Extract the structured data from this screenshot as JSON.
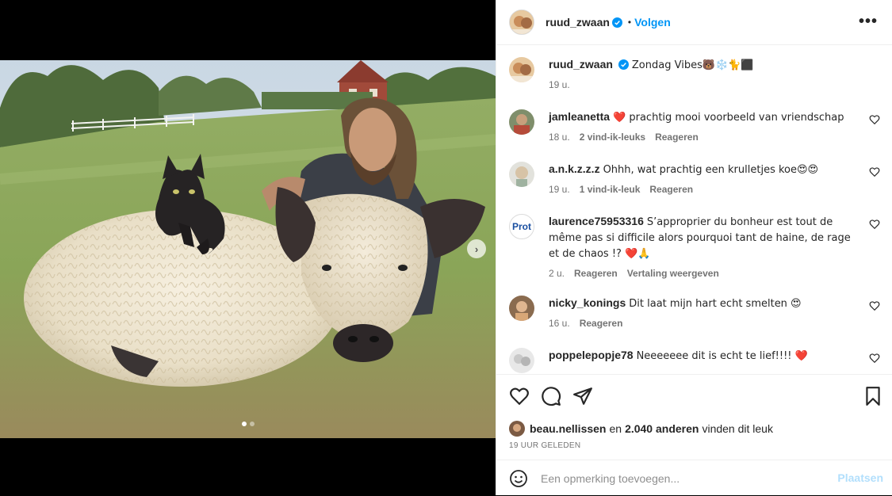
{
  "author": {
    "username": "ruud_zwaan",
    "follow_label": "Volgen",
    "separator": "•",
    "more_label": "•••"
  },
  "caption": {
    "username": "ruud_zwaan",
    "text": "Zondag Vibes🐻❄️🐈⬛",
    "time": "19 u."
  },
  "comments": [
    {
      "username": "jamleanetta",
      "text": "❤️ prachtig mooi voorbeeld van vriendschap",
      "time": "18 u.",
      "likes": "2 vind-ik-leuks",
      "reply": "Reageren"
    },
    {
      "username": "a.n.k.z.z.z",
      "text": "Ohhh, wat prachtig een krulletjes koe😍😍",
      "time": "19 u.",
      "likes": "1 vind-ik-leuk",
      "reply": "Reageren"
    },
    {
      "username": "laurence75953316",
      "text": "S’approprier du bonheur est tout de même pas si difficile alors pourquoi tant de haine, de rage et de chaos !? ❤️🙏",
      "time": "2 u.",
      "reply": "Reageren",
      "translate": "Vertaling weergeven",
      "avatar_text": "Prot"
    },
    {
      "username": "nicky_konings",
      "text": "Dit laat mijn hart echt smelten 😍",
      "time": "16 u.",
      "reply": "Reageren"
    },
    {
      "username": "poppelepopje78",
      "text": "Neeeeeee dit is echt te lief!!!! ❤️"
    }
  ],
  "likes_line": {
    "user": "beau.nellissen",
    "connector": "en",
    "count": "2.040 anderen",
    "suffix": "vinden dit leuk"
  },
  "timestamp": "19 UUR GELEDEN",
  "add_comment": {
    "placeholder": "Een opmerking toevoegen...",
    "post_label": "Plaatsen"
  },
  "carousel": {
    "slides": 2,
    "active": 1,
    "next_icon": "chevron-right-icon"
  },
  "colors": {
    "link": "#0095f6",
    "verified": "#0095f6",
    "muted": "#737373",
    "post_disabled": "#b2dffc"
  }
}
